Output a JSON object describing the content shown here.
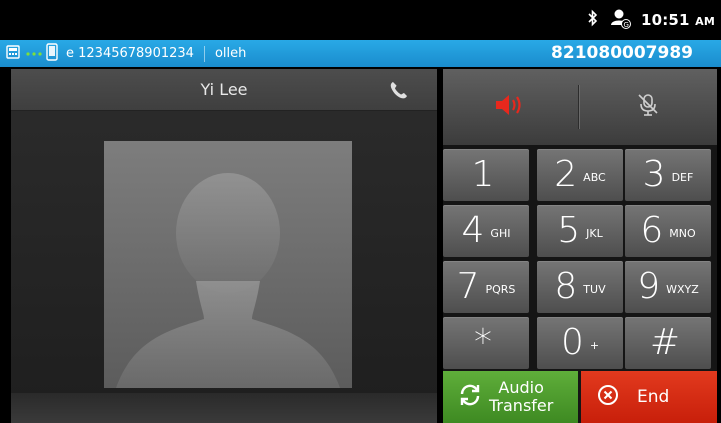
{
  "status_bar": {
    "time": "10:51",
    "ampm": "AM",
    "icons": [
      "bluetooth-icon",
      "sync-account-icon"
    ]
  },
  "info_bar": {
    "carrier_id": "e 12345678901234",
    "network": "olleh",
    "number": "821080007989",
    "icons": [
      "phone-device-icon",
      "connection-dots-icon",
      "mobile-device-icon"
    ]
  },
  "caller": {
    "name": "Yi Lee"
  },
  "audio_controls": {
    "speaker_icon": "speaker-icon",
    "speaker_color": "#e8281d",
    "mute_icon": "mic-muted-icon"
  },
  "keypad": {
    "keys": [
      {
        "digit": "1",
        "letters": ""
      },
      {
        "digit": "2",
        "letters": "ABC"
      },
      {
        "digit": "3",
        "letters": "DEF"
      },
      {
        "digit": "4",
        "letters": "GHI"
      },
      {
        "digit": "5",
        "letters": "JKL"
      },
      {
        "digit": "6",
        "letters": "MNO"
      },
      {
        "digit": "7",
        "letters": "PQRS"
      },
      {
        "digit": "8",
        "letters": "TUV"
      },
      {
        "digit": "9",
        "letters": "WXYZ"
      },
      {
        "digit": "*",
        "letters": ""
      },
      {
        "digit": "0",
        "letters": "+"
      },
      {
        "digit": "#",
        "letters": ""
      }
    ]
  },
  "actions": {
    "audio_transfer_line1": "Audio",
    "audio_transfer_line2": "Transfer",
    "end_label": "End",
    "transfer_color": "#4f9e2e",
    "end_color": "#d62b12"
  }
}
